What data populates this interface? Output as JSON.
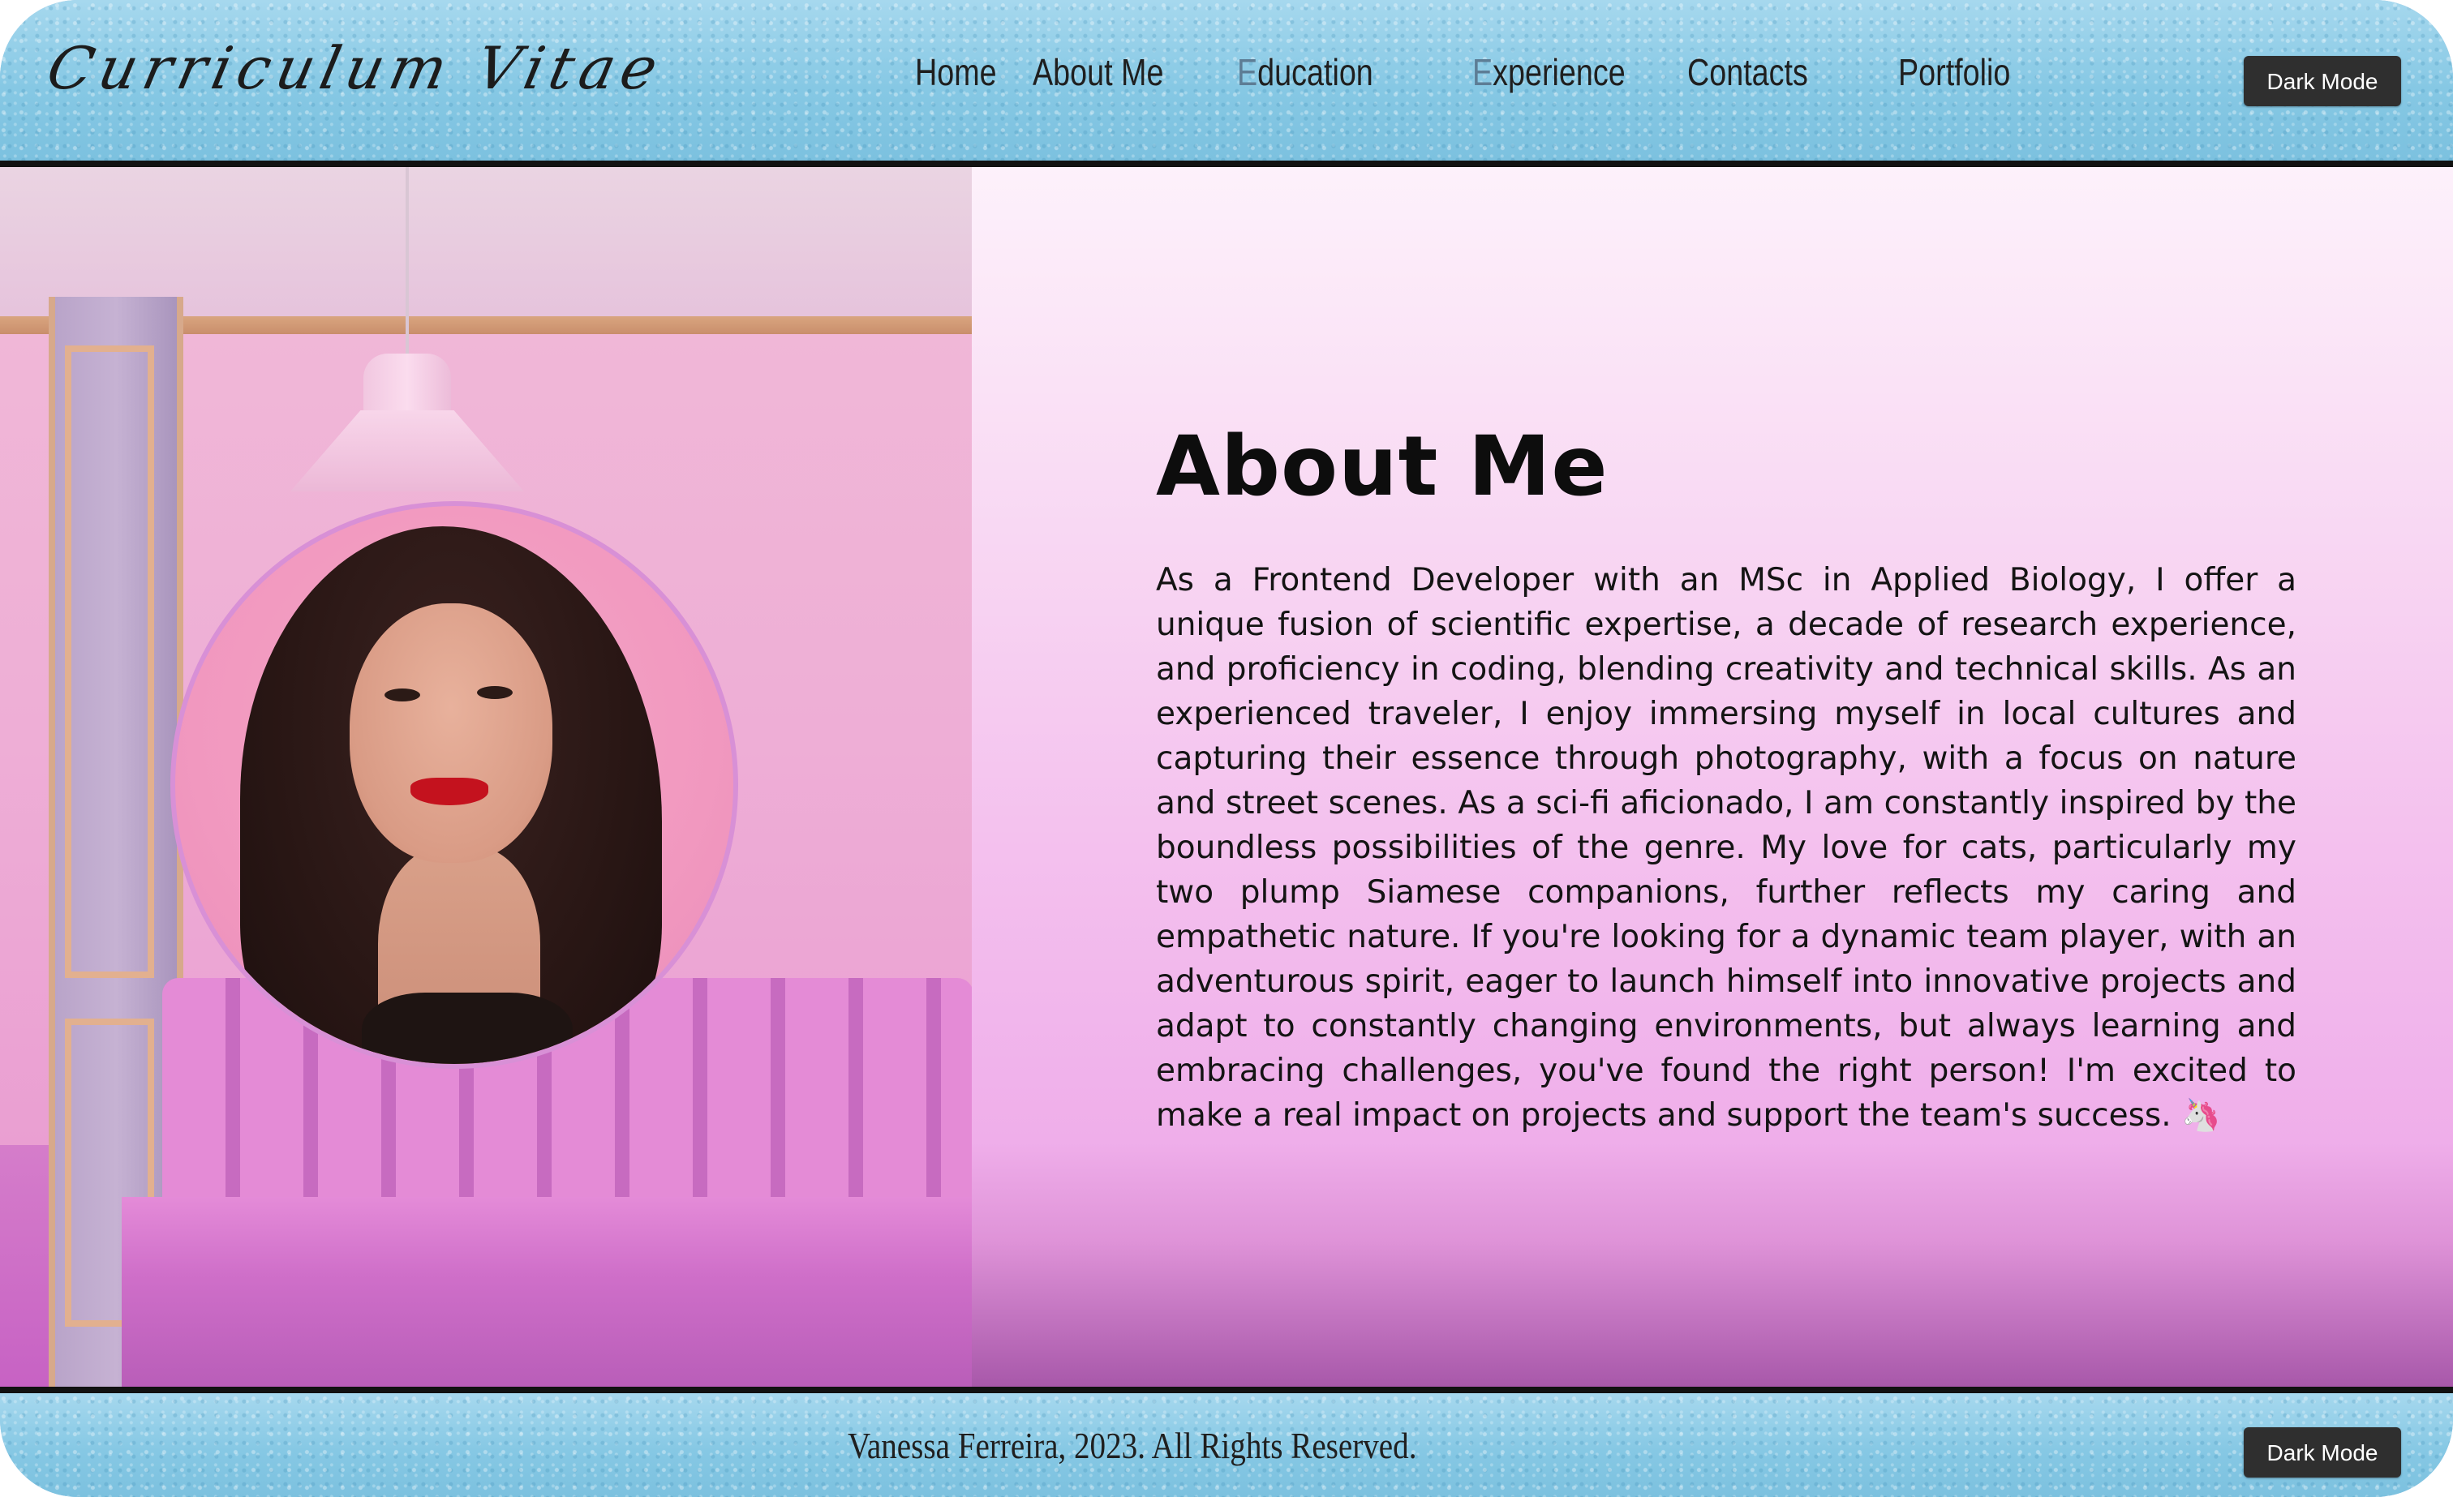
{
  "header": {
    "logo": "Curriculum Vitae",
    "nav": [
      {
        "label": "Home",
        "first_letter": "",
        "rest": "Home"
      },
      {
        "label": "About Me",
        "first_letter": "",
        "rest": "About Me"
      },
      {
        "label": "Education",
        "first_letter": "E",
        "rest": "ducation"
      },
      {
        "label": "Experience",
        "first_letter": "E",
        "rest": "xperience"
      },
      {
        "label": "Contacts",
        "first_letter": "",
        "rest": "Contacts"
      },
      {
        "label": "Portfolio",
        "first_letter": "",
        "rest": "Portfolio"
      }
    ],
    "dark_mode_label": "Dark Mode"
  },
  "about": {
    "title": "About Me",
    "body": "As a Frontend Developer with an MSc in Applied Biology, I offer a unique fusion of scientific expertise, a decade of research experience, and proficiency in coding, blending creativity and technical skills. As an experienced traveler, I enjoy immersing myself in local cultures and capturing their essence through photography, with a focus on nature and street scenes. As a sci-fi aficionado, I am constantly inspired by the boundless possibilities of the genre. My love for cats, particularly my two plump Siamese companions, further reflects my caring and empathetic nature. If you're looking for a dynamic team player, with an adventurous spirit, eager to launch himself into innovative projects and adapt to constantly changing environments, but always learning and embracing challenges, you've found the right person! I'm excited to make a real impact on projects and support the team's success. 🦄"
  },
  "footer": {
    "copyright": "Vanessa Ferreira, 2023. All Rights Reserved.",
    "dark_mode_label": "Dark Mode"
  },
  "colors": {
    "bar_blue": "#8fcde7",
    "accent_letter": "#5d7d95",
    "button_bg": "#2f2f2f",
    "pane_pink": "#f4c1ee"
  }
}
